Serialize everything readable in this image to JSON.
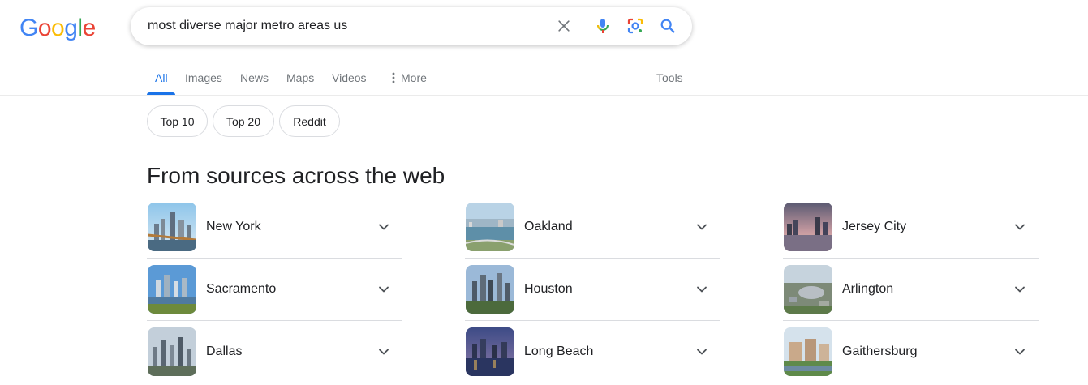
{
  "logo": {
    "letters": [
      "G",
      "o",
      "o",
      "g",
      "l",
      "e"
    ],
    "colors": [
      "#4285f4",
      "#ea4335",
      "#fbbc05",
      "#4285f4",
      "#34a853",
      "#ea4335"
    ]
  },
  "search": {
    "query": "most diverse major metro areas us"
  },
  "tabs": [
    {
      "label": "All",
      "active": true
    },
    {
      "label": "Images"
    },
    {
      "label": "News"
    },
    {
      "label": "Maps"
    },
    {
      "label": "Videos"
    },
    {
      "label": "More"
    }
  ],
  "tools_label": "Tools",
  "chips": [
    "Top 10",
    "Top 20",
    "Reddit"
  ],
  "section_title": "From sources across the web",
  "cities": [
    {
      "name": "New York",
      "icon": "chevron-down-icon"
    },
    {
      "name": "Oakland",
      "icon": "chevron-down-icon"
    },
    {
      "name": "Jersey City",
      "icon": "chevron-down-icon"
    },
    {
      "name": "Sacramento",
      "icon": "chevron-down-icon"
    },
    {
      "name": "Houston",
      "icon": "chevron-down-icon"
    },
    {
      "name": "Arlington",
      "icon": "chevron-down-icon"
    },
    {
      "name": "Dallas",
      "icon": "chevron-down-icon"
    },
    {
      "name": "Long Beach",
      "icon": "chevron-down-icon"
    },
    {
      "name": "Gaithersburg",
      "icon": "chevron-down-icon"
    }
  ],
  "colors": {
    "accent": "#1a73e8",
    "text": "#202124",
    "muted": "#70757a",
    "border": "#dadce0"
  }
}
